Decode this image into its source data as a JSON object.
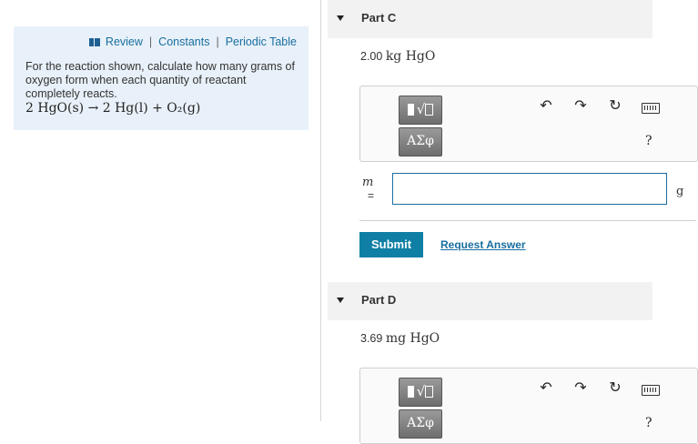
{
  "left_panel": {
    "links": {
      "review": "Review",
      "constants": "Constants",
      "periodic_table": "Periodic Table"
    },
    "prompt": "For the reaction shown, calculate how many grams of oxygen form when each quantity of reactant completely reacts.",
    "reaction": "2 HgO(s) → 2 Hg(l) + O₂(g)"
  },
  "part_c": {
    "label": "Part C",
    "given_value": "2.00",
    "given_unit": "kg HgO",
    "toolbar": {
      "template_glyph": "√",
      "greek_label": "ΑΣφ",
      "help": "?"
    },
    "variable": "m",
    "equals": "=",
    "answer_value": "",
    "answer_unit": "g",
    "submit_label": "Submit",
    "request_answer_label": "Request Answer"
  },
  "part_d": {
    "label": "Part D",
    "given_value": "3.69",
    "given_unit": "mg HgO",
    "toolbar": {
      "template_glyph": "√",
      "greek_label": "ΑΣφ",
      "help": "?"
    }
  },
  "icons": [
    "book-icon",
    "undo-icon",
    "redo-icon",
    "reset-icon",
    "keyboard-icon"
  ],
  "colors": {
    "panel_bg": "#e8f1f9",
    "link": "#1a6ea0",
    "submit_bg": "#0f7fa5"
  }
}
